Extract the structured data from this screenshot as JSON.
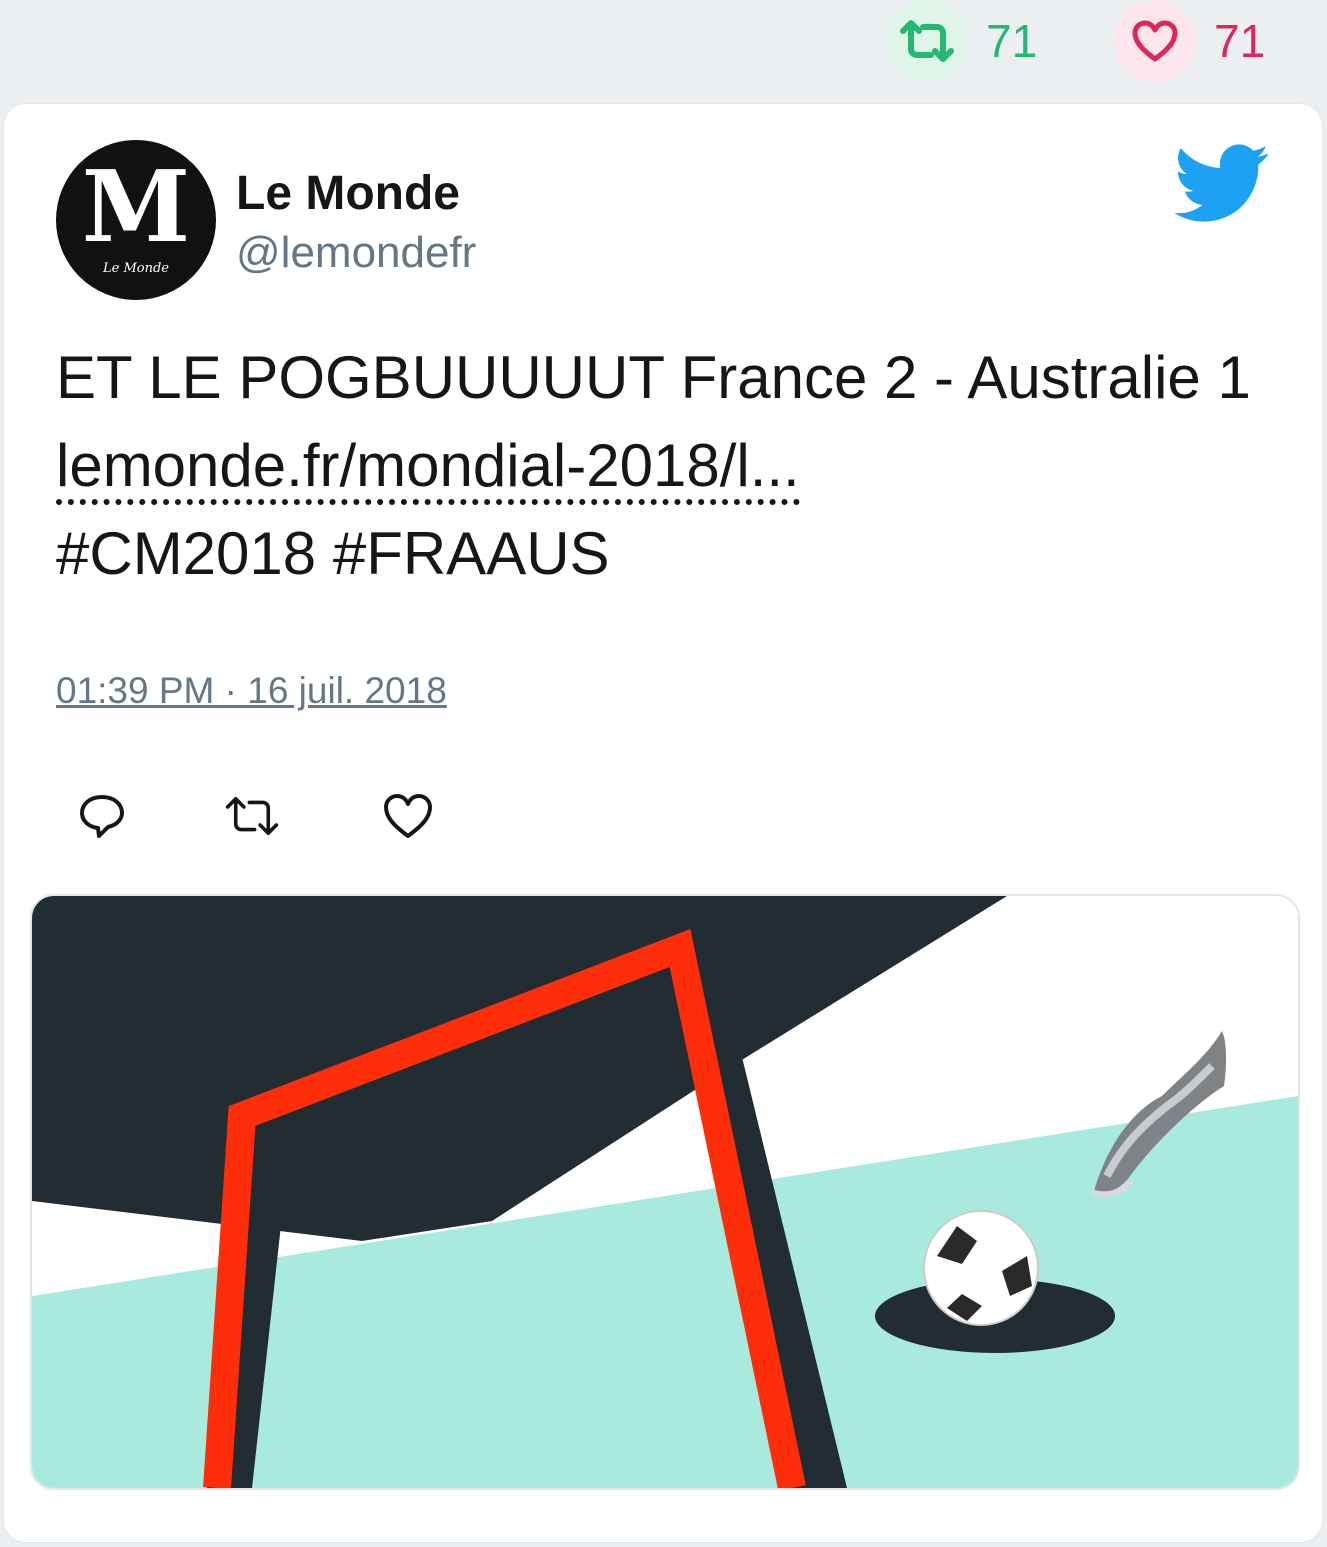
{
  "top_stats": {
    "retweet_icon": "retweet-icon",
    "retweets": "71",
    "like_icon": "heart-icon",
    "likes": "71",
    "colors": {
      "retweet": "#25b873",
      "like": "#e0245e"
    }
  },
  "tweet": {
    "author": {
      "name": "Le Monde",
      "handle": "@lemondefr",
      "avatar_icon": "le-monde-logo",
      "avatar_letter": "M",
      "avatar_caption": "Le Monde"
    },
    "brand_icon": "twitter-bird-icon",
    "brand_color": "#1da1f2",
    "text_part1": "ET LE POGBUUUUUT France 2 - Australie 1 ",
    "link": "lemonde.fr/mondial-2018/l...",
    "hashtags": "#CM2018 #FRAAUS",
    "timestamp": "01:39 PM · 16 juil. 2018",
    "actions": [
      {
        "name": "reply",
        "icon": "reply-icon"
      },
      {
        "name": "retweet",
        "icon": "retweet-icon"
      },
      {
        "name": "like",
        "icon": "heart-icon"
      }
    ],
    "media": {
      "icon": "football-goal-illustration",
      "colors": {
        "dark": "#222d33",
        "goal": "#ff2e0a",
        "pitch": "#a8ebde",
        "sky": "#ffffff"
      }
    }
  }
}
